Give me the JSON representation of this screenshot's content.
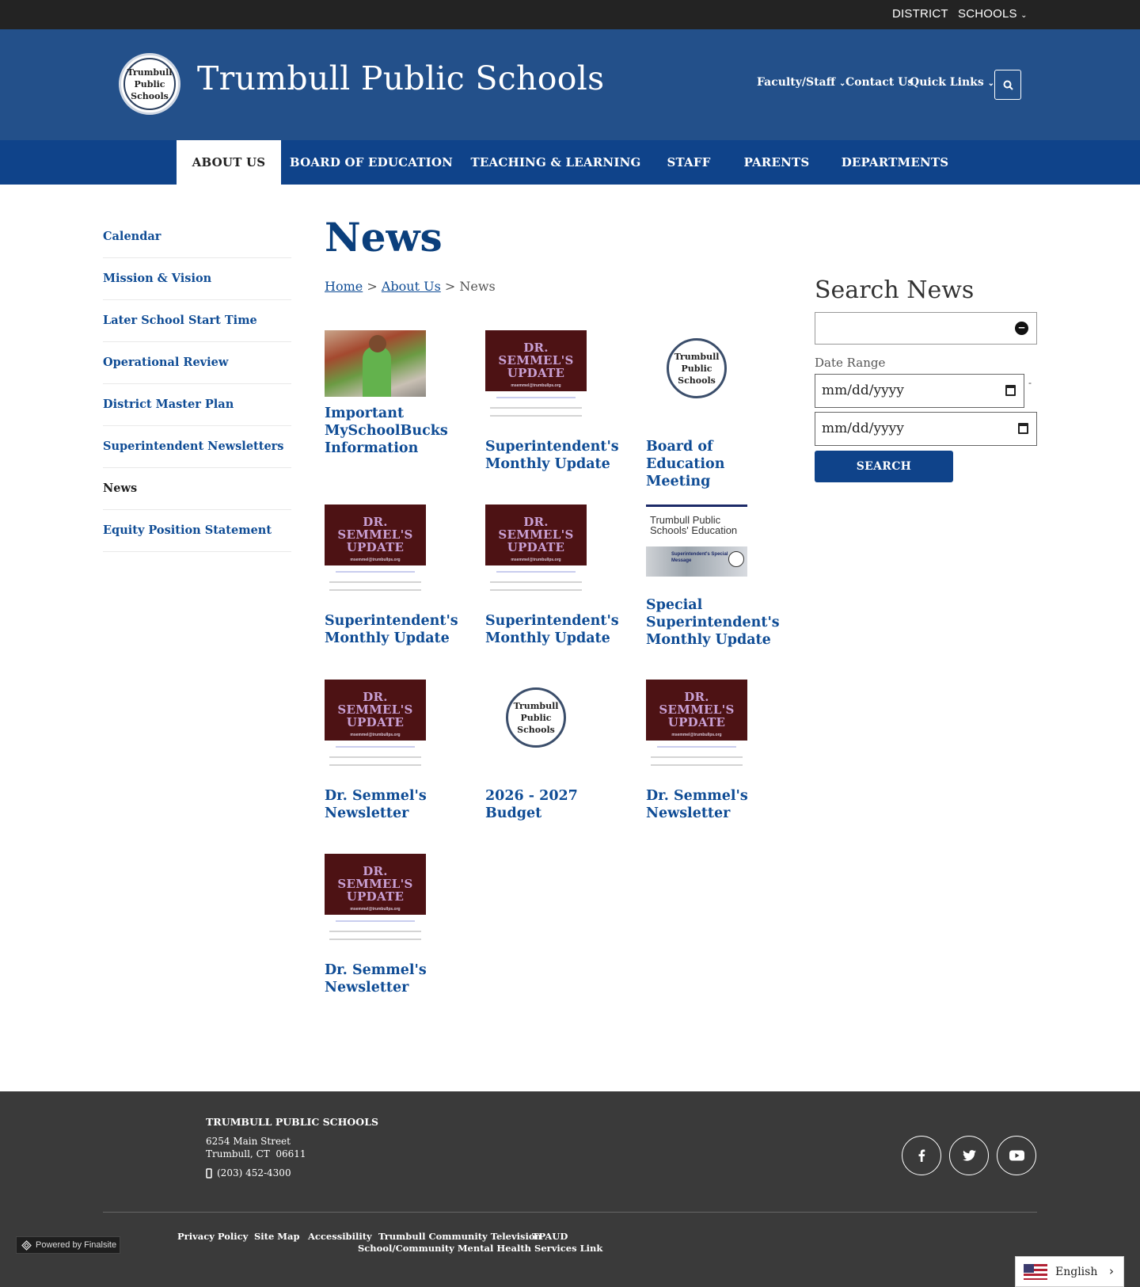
{
  "topbar": {
    "district": "DISTRICT",
    "schools": "SCHOOLS"
  },
  "header": {
    "logo_lines": [
      "Trumbull",
      "Public",
      "Schools"
    ],
    "site_title": "Trumbull Public Schools",
    "links": {
      "faculty": "Faculty/Staff",
      "contact": "Contact Us",
      "quick": "Quick Links"
    }
  },
  "nav": [
    "ABOUT US",
    "BOARD OF EDUCATION",
    "TEACHING & LEARNING",
    "STAFF",
    "PARENTS",
    "DEPARTMENTS"
  ],
  "sidebar": [
    "Calendar",
    "Mission & Vision",
    "Later School Start Time",
    "Operational Review",
    "District Master Plan",
    "Superintendent Newsletters",
    "News",
    "Equity Position Statement"
  ],
  "page": {
    "title": "News",
    "breadcrumb": {
      "home": "Home",
      "sep": ">",
      "about": "About Us",
      "current": "News"
    }
  },
  "thumb": {
    "update_title": "DR. SEMMEL'S UPDATE",
    "update_email": "msemmel@trumbullps.org",
    "special_title": "Trumbull Public Schools' Education",
    "special_sub": "Superintendent's Special Message"
  },
  "news": [
    {
      "title": "Important MySchoolBucks Information",
      "thumb": "photo"
    },
    {
      "title": "Superintendent's Monthly Update",
      "thumb": "update"
    },
    {
      "title": "Board of Education Meeting",
      "thumb": "logo"
    },
    {
      "title": "Superintendent's Monthly Update",
      "thumb": "update"
    },
    {
      "title": "Superintendent's Monthly Update",
      "thumb": "update"
    },
    {
      "title": "Special Superintendent's Monthly Update",
      "thumb": "special"
    },
    {
      "title": "Dr. Semmel's Newsletter",
      "thumb": "update"
    },
    {
      "title": "2026 - 2027 Budget",
      "thumb": "logo"
    },
    {
      "title": "Dr. Semmel's Newsletter",
      "thumb": "update"
    },
    {
      "title": "Dr. Semmel's Newsletter",
      "thumb": "update"
    }
  ],
  "search": {
    "title": "Search News",
    "date_range_label": "Date Range",
    "date_placeholder": "mm/dd/yyyy",
    "dash": "-",
    "button": "SEARCH"
  },
  "footer": {
    "name": "TRUMBULL PUBLIC SCHOOLS",
    "address1": "6254 Main Street",
    "address2": "Trumbull, CT  06611",
    "phone": "(203) 452-4300",
    "links": [
      "Privacy Policy",
      "Site Map",
      "Accessibility",
      "Trumbull Community Television",
      "TPAUD",
      "School/Community Mental Health Services Link"
    ],
    "powered": "Powered by Finalsite",
    "language": "English"
  },
  "colors": {
    "header": "#23508a",
    "nav": "#0f438a",
    "link": "#0f4c95",
    "footer": "#3a3a3a"
  }
}
